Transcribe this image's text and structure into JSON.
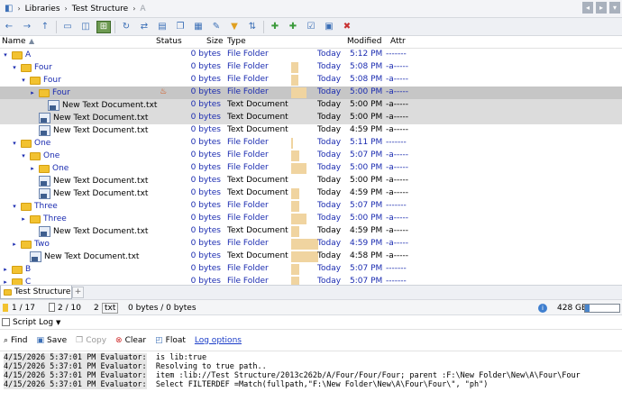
{
  "breadcrumb": {
    "items": [
      "Libraries",
      "Test Structure",
      "A"
    ]
  },
  "columns": {
    "name": "Name",
    "status": "Status",
    "size": "Size",
    "type": "Type",
    "modified": "Modified",
    "attr": "Attr"
  },
  "rows": [
    {
      "name": "A",
      "indent": 0,
      "kind": "folder",
      "twisty": "▾",
      "size": "0 bytes",
      "type": "File Folder",
      "modified": "Today",
      "time": "5:12 PM",
      "attr": "-------",
      "bar": 0,
      "color": "blue"
    },
    {
      "name": "Four",
      "indent": 1,
      "kind": "folder",
      "twisty": "▾",
      "size": "0 bytes",
      "type": "File Folder",
      "modified": "Today",
      "time": "5:08 PM",
      "attr": "-a-----",
      "bar": 0.28,
      "color": "blue"
    },
    {
      "name": "Four",
      "indent": 2,
      "kind": "folder",
      "twisty": "▾",
      "size": "0 bytes",
      "type": "File Folder",
      "modified": "Today",
      "time": "5:08 PM",
      "attr": "-a-----",
      "bar": 0.28,
      "color": "blue"
    },
    {
      "name": "Four",
      "indent": 3,
      "kind": "folder",
      "twisty": "▸",
      "size": "0 bytes",
      "type": "File Folder",
      "modified": "Today",
      "time": "5:00 PM",
      "attr": "-a-----",
      "bar": 0.55,
      "color": "blue",
      "sel": "sel2",
      "status": "fire"
    },
    {
      "name": "New Text Document.txt",
      "indent": 4,
      "kind": "doc",
      "twisty": "",
      "size": "0 bytes",
      "type": "Text Document",
      "modified": "Today",
      "time": "5:00 PM",
      "attr": "-a-----",
      "bar": 0,
      "color": "black",
      "sel": "sel"
    },
    {
      "name": "New Text Document.txt",
      "indent": 3,
      "kind": "doc",
      "twisty": "",
      "size": "0 bytes",
      "type": "Text Document",
      "modified": "Today",
      "time": "5:00 PM",
      "attr": "-a-----",
      "bar": 0,
      "color": "black",
      "sel": "sel"
    },
    {
      "name": "New Text Document.txt",
      "indent": 3,
      "kind": "doc",
      "twisty": "",
      "size": "0 bytes",
      "type": "Text Document",
      "modified": "Today",
      "time": "4:59 PM",
      "attr": "-a-----",
      "bar": 0,
      "color": "black"
    },
    {
      "name": "One",
      "indent": 1,
      "kind": "folder",
      "twisty": "▾",
      "size": "0 bytes",
      "type": "File Folder",
      "modified": "Today",
      "time": "5:11 PM",
      "attr": "-------",
      "bar": 0.05,
      "color": "blue"
    },
    {
      "name": "One",
      "indent": 2,
      "kind": "folder",
      "twisty": "▾",
      "size": "0 bytes",
      "type": "File Folder",
      "modified": "Today",
      "time": "5:07 PM",
      "attr": "-a-----",
      "bar": 0.3,
      "color": "blue"
    },
    {
      "name": "One",
      "indent": 3,
      "kind": "folder",
      "twisty": "▸",
      "size": "0 bytes",
      "type": "File Folder",
      "modified": "Today",
      "time": "5:00 PM",
      "attr": "-a-----",
      "bar": 0.55,
      "color": "blue"
    },
    {
      "name": "New Text Document.txt",
      "indent": 3,
      "kind": "doc",
      "twisty": "",
      "size": "0 bytes",
      "type": "Text Document",
      "modified": "Today",
      "time": "5:00 PM",
      "attr": "-a-----",
      "bar": 0,
      "color": "black"
    },
    {
      "name": "New Text Document.txt",
      "indent": 3,
      "kind": "doc",
      "twisty": "",
      "size": "0 bytes",
      "type": "Text Document",
      "modified": "Today",
      "time": "4:59 PM",
      "attr": "-a-----",
      "bar": 0.3,
      "color": "black"
    },
    {
      "name": "Three",
      "indent": 1,
      "kind": "folder",
      "twisty": "▾",
      "size": "0 bytes",
      "type": "File Folder",
      "modified": "Today",
      "time": "5:07 PM",
      "attr": "-------",
      "bar": 0.3,
      "color": "blue"
    },
    {
      "name": "Three",
      "indent": 2,
      "kind": "folder",
      "twisty": "▸",
      "size": "0 bytes",
      "type": "File Folder",
      "modified": "Today",
      "time": "5:00 PM",
      "attr": "-a-----",
      "bar": 0.55,
      "color": "blue"
    },
    {
      "name": "New Text Document.txt",
      "indent": 3,
      "kind": "doc",
      "twisty": "",
      "size": "0 bytes",
      "type": "Text Document",
      "modified": "Today",
      "time": "4:59 PM",
      "attr": "-a-----",
      "bar": 0.3,
      "color": "black"
    },
    {
      "name": "Two",
      "indent": 1,
      "kind": "folder",
      "twisty": "▸",
      "size": "0 bytes",
      "type": "File Folder",
      "modified": "Today",
      "time": "4:59 PM",
      "attr": "-a-----",
      "bar": 1,
      "color": "blue"
    },
    {
      "name": "New Text Document.txt",
      "indent": 2,
      "kind": "doc",
      "twisty": "",
      "size": "0 bytes",
      "type": "Text Document",
      "modified": "Today",
      "time": "4:58 PM",
      "attr": "-a-----",
      "bar": 1,
      "color": "black"
    },
    {
      "name": "B",
      "indent": 0,
      "kind": "folder",
      "twisty": "▸",
      "size": "0 bytes",
      "type": "File Folder",
      "modified": "Today",
      "time": "5:07 PM",
      "attr": "-------",
      "bar": 0.3,
      "color": "blue"
    },
    {
      "name": "C",
      "indent": 0,
      "kind": "folder",
      "twisty": "▸",
      "size": "0 bytes",
      "type": "File Folder",
      "modified": "Today",
      "time": "5:07 PM",
      "attr": "-------",
      "bar": 0.3,
      "color": "blue"
    }
  ],
  "tab": {
    "label": "Test Structure",
    "plus": "+"
  },
  "status": {
    "folders": "1 / 17",
    "files": "2 / 10",
    "count": "2",
    "ext": "txt",
    "bytes": "0 bytes / 0 bytes",
    "disk": "428 GB",
    "disk_used": 0.12
  },
  "log": {
    "title": "Script Log",
    "buttons": {
      "find": "Find",
      "save": "Save",
      "copy": "Copy",
      "clear": "Clear",
      "float": "Float",
      "options": "Log options"
    },
    "lines": [
      {
        "prefix": "4/15/2026 5:37:01 PM Evaluator:",
        "text": "is lib:true"
      },
      {
        "prefix": "4/15/2026 5:37:01 PM Evaluator:",
        "text": "Resolving to true path.."
      },
      {
        "prefix": "4/15/2026 5:37:01 PM Evaluator:",
        "text": "item :lib://Test Structure/2013c262b/A/Four/Four/Four; parent :F:\\New Folder\\New\\A\\Four\\Four"
      },
      {
        "prefix": "4/15/2026 5:37:01 PM Evaluator:",
        "text": "Select FILTERDEF =Match(fullpath,\"F:\\New Folder\\New\\A\\Four\\Four\\\", \"ph\")"
      }
    ]
  }
}
